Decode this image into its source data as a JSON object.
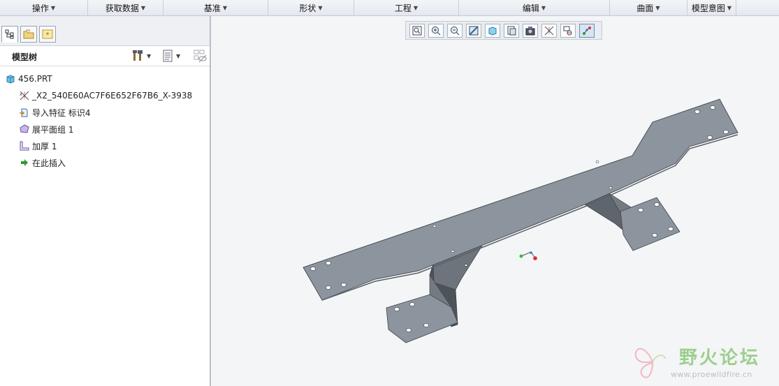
{
  "ribbon": {
    "groups": [
      {
        "label": "操作"
      },
      {
        "label": "获取数据"
      },
      {
        "label": "基准"
      },
      {
        "label": "形状"
      },
      {
        "label": "工程"
      },
      {
        "label": "编辑"
      },
      {
        "label": "曲面"
      },
      {
        "label": "模型意图"
      }
    ]
  },
  "panel": {
    "tree_title": "模型树",
    "items": [
      {
        "label": "456.PRT",
        "icon": "part-icon"
      },
      {
        "label": "_X2_540E60AC7F6E652F67B6_X-3938",
        "icon": "coordinate-system-icon"
      },
      {
        "label": "导入特征 标识4",
        "icon": "import-feature-icon"
      },
      {
        "label": "展平面组 1",
        "icon": "flatten-quilt-icon"
      },
      {
        "label": "加厚 1",
        "icon": "thicken-icon"
      },
      {
        "label": "在此插入",
        "icon": "insert-here-arrow-icon"
      }
    ]
  },
  "view_toolbar": {
    "buttons": [
      "refit-icon",
      "zoom-in-icon",
      "zoom-out-icon",
      "repaint-icon",
      "display-style-icon",
      "saved-views-icon",
      "view-manager-icon",
      "datum-display-icon",
      "spin-center-icon",
      "annotation-display-icon"
    ]
  },
  "colors": {
    "part_fill": "#8c949d",
    "part_edge": "#3f454b",
    "selected_button": "#d7e4f2"
  },
  "watermark": {
    "text": "野火论坛",
    "url": "www.proewildfire.cn"
  }
}
